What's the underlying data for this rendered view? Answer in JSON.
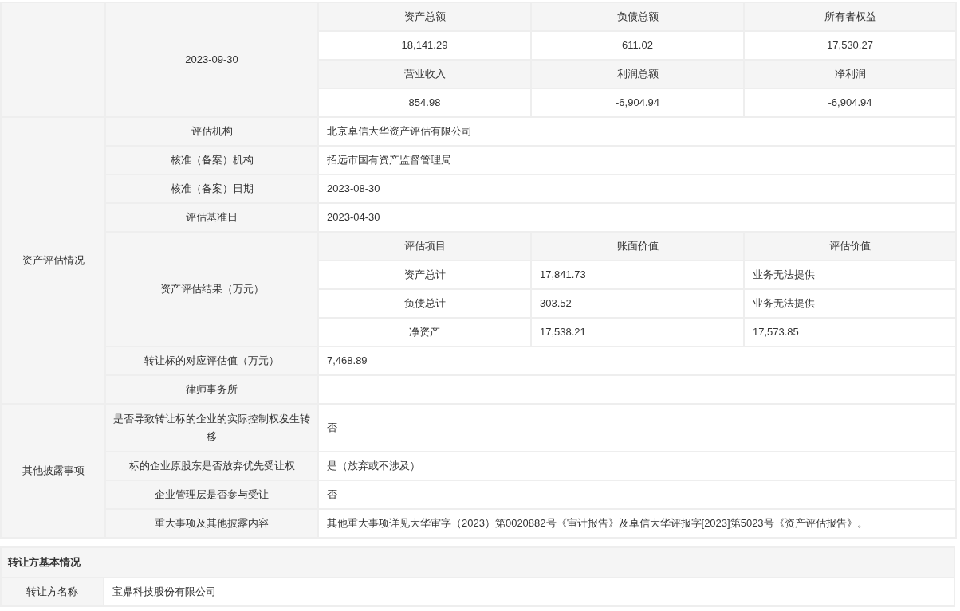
{
  "financial_block": {
    "date": "2023-09-30",
    "rows": [
      {
        "kind": "header",
        "cells": [
          "资产总额",
          "负债总额",
          "所有者权益"
        ]
      },
      {
        "kind": "value",
        "cells": [
          "18,141.29",
          "611.02",
          "17,530.27"
        ]
      },
      {
        "kind": "header",
        "cells": [
          "营业收入",
          "利润总额",
          "净利润"
        ]
      },
      {
        "kind": "value",
        "cells": [
          "854.98",
          "-6,904.94",
          "-6,904.94"
        ]
      }
    ]
  },
  "asset_evaluation": {
    "title": "资产评估情况",
    "fields": [
      {
        "label": "评估机构",
        "value": "北京卓信大华资产评估有限公司"
      },
      {
        "label": "核准（备案）机构",
        "value": "招远市国有资产监督管理局"
      },
      {
        "label": "核准（备案）日期",
        "value": "2023-08-30"
      },
      {
        "label": "评估基准日",
        "value": "2023-04-30"
      }
    ],
    "result": {
      "label": "资产评估结果（万元）",
      "columns": [
        "评估项目",
        "账面价值",
        "评估价值"
      ],
      "rows": [
        [
          "资产总计",
          "17,841.73",
          "业务无法提供"
        ],
        [
          "负债总计",
          "303.52",
          "业务无法提供"
        ],
        [
          "净资产",
          "17,538.21",
          "17,573.85"
        ]
      ]
    },
    "fields_after": [
      {
        "label": "转让标的对应评估值（万元）",
        "value": "7,468.89"
      },
      {
        "label": "律师事务所"
      }
    ]
  },
  "other_disclosures": {
    "title": "其他披露事项",
    "fields": [
      {
        "label": "是否导致转让标的企业的实际控制权发生转移",
        "value": "否"
      },
      {
        "label": "标的企业原股东是否放弃优先受让权",
        "value": "是（放弃或不涉及）"
      },
      {
        "label": "企业管理层是否参与受让",
        "value": "否"
      },
      {
        "label": "重大事项及其他披露内容",
        "value": "其他重大事项详见大华审字（2023）第0020882号《审计报告》及卓信大华评报字[2023]第5023号《资产评估报告》。"
      }
    ]
  },
  "transferor": {
    "heading": "转让方基本情况",
    "fields": [
      {
        "label": "转让方名称",
        "value": "宝鼎科技股份有限公司"
      }
    ]
  }
}
